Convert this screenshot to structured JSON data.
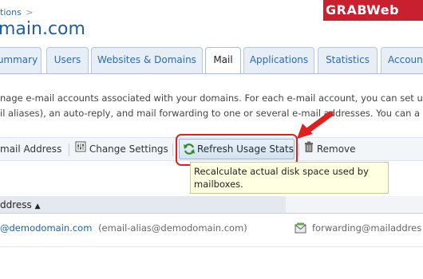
{
  "breadcrumb": {
    "text": "tions",
    "separator": ">"
  },
  "logo": {
    "text": "GRABWeb"
  },
  "page_title": "main.com",
  "tabs": [
    {
      "label": "ummary"
    },
    {
      "label": "Users"
    },
    {
      "label": "Websites & Domains"
    },
    {
      "label": "Mail",
      "active": true
    },
    {
      "label": "Applications"
    },
    {
      "label": "Statistics"
    },
    {
      "label": "Account"
    }
  ],
  "description": {
    "line1": "nage e-mail accounts associated with your domains. For each e-mail account, you can set u",
    "line2": "il aliases), an auto-reply, and mail forwarding to one or several e-mail addresses. You can a"
  },
  "toolbar": {
    "email_label": "mail Address",
    "change_settings_label": "Change Settings",
    "refresh_label": "Refresh Usage Stats",
    "remove_label": "Remove"
  },
  "tooltip": {
    "line1": "Recalculate actual disk space used by",
    "line2": "mailboxes."
  },
  "table": {
    "header_label": "ddress",
    "sort_indicator": "▲"
  },
  "row": {
    "address": "@demodomain.com",
    "alias": "(email-alias@demodomain.com)",
    "forwarding": "forwarding@mailaddres"
  },
  "colors": {
    "accent": "#1f5f9c",
    "highlight": "#e02020",
    "logo_bg": "#c8202f"
  }
}
